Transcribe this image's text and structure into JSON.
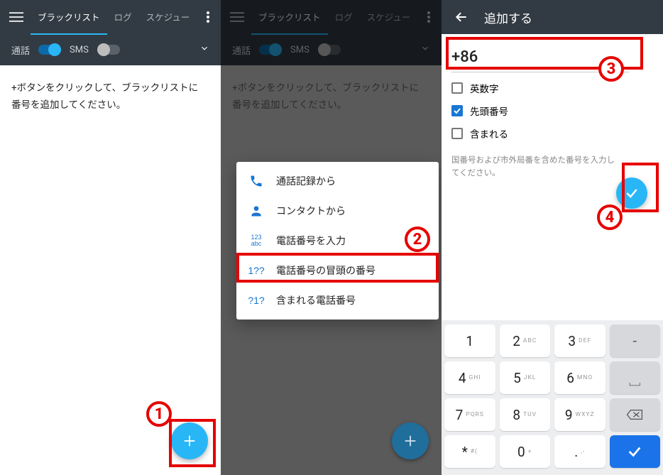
{
  "tabs": {
    "blacklist": "ブラックリスト",
    "log": "ログ",
    "schedule": "スケジュー"
  },
  "toggles": {
    "call": "通話",
    "sms": "SMS"
  },
  "body_hint": "+ボタンをクリックして、ブラックリストに\n番号を追加してください。",
  "popup": {
    "from_call_log": "通話記録から",
    "from_contacts": "コンタクトから",
    "enter_number": "電話番号を入力",
    "starts_with": "電話番号の冒頭の番号",
    "contains_number": "含まれる電話番号",
    "icon_123": "123",
    "icon_abc": "abc",
    "icon_1qq": "1??",
    "icon_q1q": "?1?"
  },
  "screen3": {
    "title": "追加する",
    "input_value": "+86",
    "cb_alnum": "英数字",
    "cb_starts": "先頭番号",
    "cb_contains": "含まれる",
    "help": "国番号および市外局番を含めた番号を入力してください。"
  },
  "keypad": {
    "k1": "1",
    "k2": "2",
    "k2l": "ABC",
    "k3": "3",
    "k3l": "DEF",
    "k4": "4",
    "k4l": "GHI",
    "k5": "5",
    "k5l": "JKL",
    "k6": "6",
    "k6l": "MNO",
    "k7": "7",
    "k7l": "PQRS",
    "k8": "8",
    "k8l": "TUV",
    "k9": "9",
    "k9l": "WXYZ",
    "kstar": "*",
    "kstarl": "#(",
    "k0": "0",
    "k0l": "+",
    "kdot": ".",
    "kdotl": ",-",
    "minus": "-",
    "space": "␣"
  },
  "anno": {
    "n1": "1",
    "n2": "2",
    "n3": "3",
    "n4": "4"
  }
}
